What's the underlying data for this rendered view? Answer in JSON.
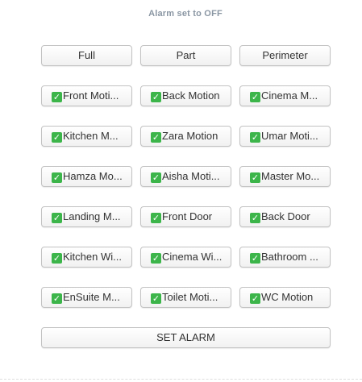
{
  "status_text": "Alarm set to OFF",
  "modes": [
    "Full",
    "Part",
    "Perimeter"
  ],
  "zones": [
    {
      "label": "Front Moti...",
      "checked": true
    },
    {
      "label": "Back Motion",
      "checked": true
    },
    {
      "label": "Cinema M...",
      "checked": true
    },
    {
      "label": "Kitchen M...",
      "checked": true
    },
    {
      "label": "Zara Motion",
      "checked": true
    },
    {
      "label": "Umar Moti...",
      "checked": true
    },
    {
      "label": "Hamza Mo...",
      "checked": true
    },
    {
      "label": "Aisha Moti...",
      "checked": true
    },
    {
      "label": "Master Mo...",
      "checked": true
    },
    {
      "label": "Landing M...",
      "checked": true
    },
    {
      "label": "Front Door",
      "checked": true
    },
    {
      "label": "Back Door",
      "checked": true
    },
    {
      "label": "Kitchen Wi...",
      "checked": true
    },
    {
      "label": "Cinema Wi...",
      "checked": true
    },
    {
      "label": "Bathroom ...",
      "checked": true
    },
    {
      "label": "EnSuite M...",
      "checked": true
    },
    {
      "label": "Toilet Moti...",
      "checked": true
    },
    {
      "label": "WC Motion",
      "checked": true
    }
  ],
  "set_button": "SET ALARM",
  "check_glyph": "✓",
  "colors": {
    "status_text": "#8a96a3",
    "check_bg": "#3cb54a",
    "button_border": "#c2c2c2"
  }
}
